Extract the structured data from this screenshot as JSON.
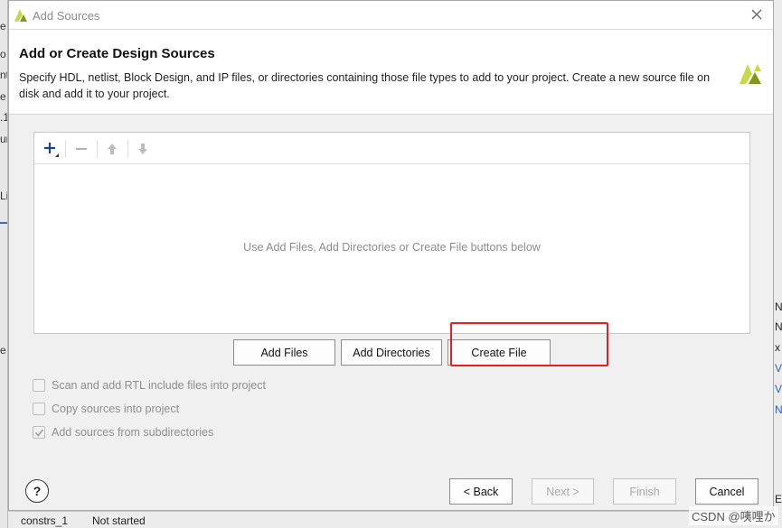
{
  "window": {
    "title": "Add Sources"
  },
  "header": {
    "heading": "Add or Create Design Sources",
    "description": "Specify HDL, netlist, Block Design, and IP files, or directories containing those file types to add to your project. Create a new source file on disk and add it to your project."
  },
  "toolbar": {
    "icons": [
      "add-icon",
      "remove-icon",
      "move-up-icon",
      "move-down-icon"
    ]
  },
  "file_list": {
    "empty_message": "Use Add Files, Add Directories or Create File buttons below"
  },
  "actions": {
    "add_files": "Add Files",
    "add_directories": "Add Directories",
    "create_file": "Create File"
  },
  "options": [
    {
      "label": "Scan and add RTL include files into project",
      "checked": false
    },
    {
      "label": "Copy sources into project",
      "checked": false
    },
    {
      "label": "Add sources from subdirectories",
      "checked": true
    }
  ],
  "footer": {
    "help": "?",
    "back": "< Back",
    "next": "Next >",
    "finish": "Finish",
    "cancel": "Cancel"
  },
  "background": {
    "left_fragments": [
      "e",
      "o",
      "nt",
      "e",
      ".1",
      "ur",
      "Li",
      "e"
    ],
    "right_fragments": [
      "N",
      "N",
      "x",
      "V",
      "V",
      "N",
      "El"
    ],
    "bottom_fragments": [
      "constrs_1",
      "Not started"
    ]
  },
  "watermark": "CSDN @咦哩か",
  "colors": {
    "highlight": "#e81e1e",
    "logo_primary": "#c9d84a",
    "logo_secondary": "#7f9a1a"
  }
}
